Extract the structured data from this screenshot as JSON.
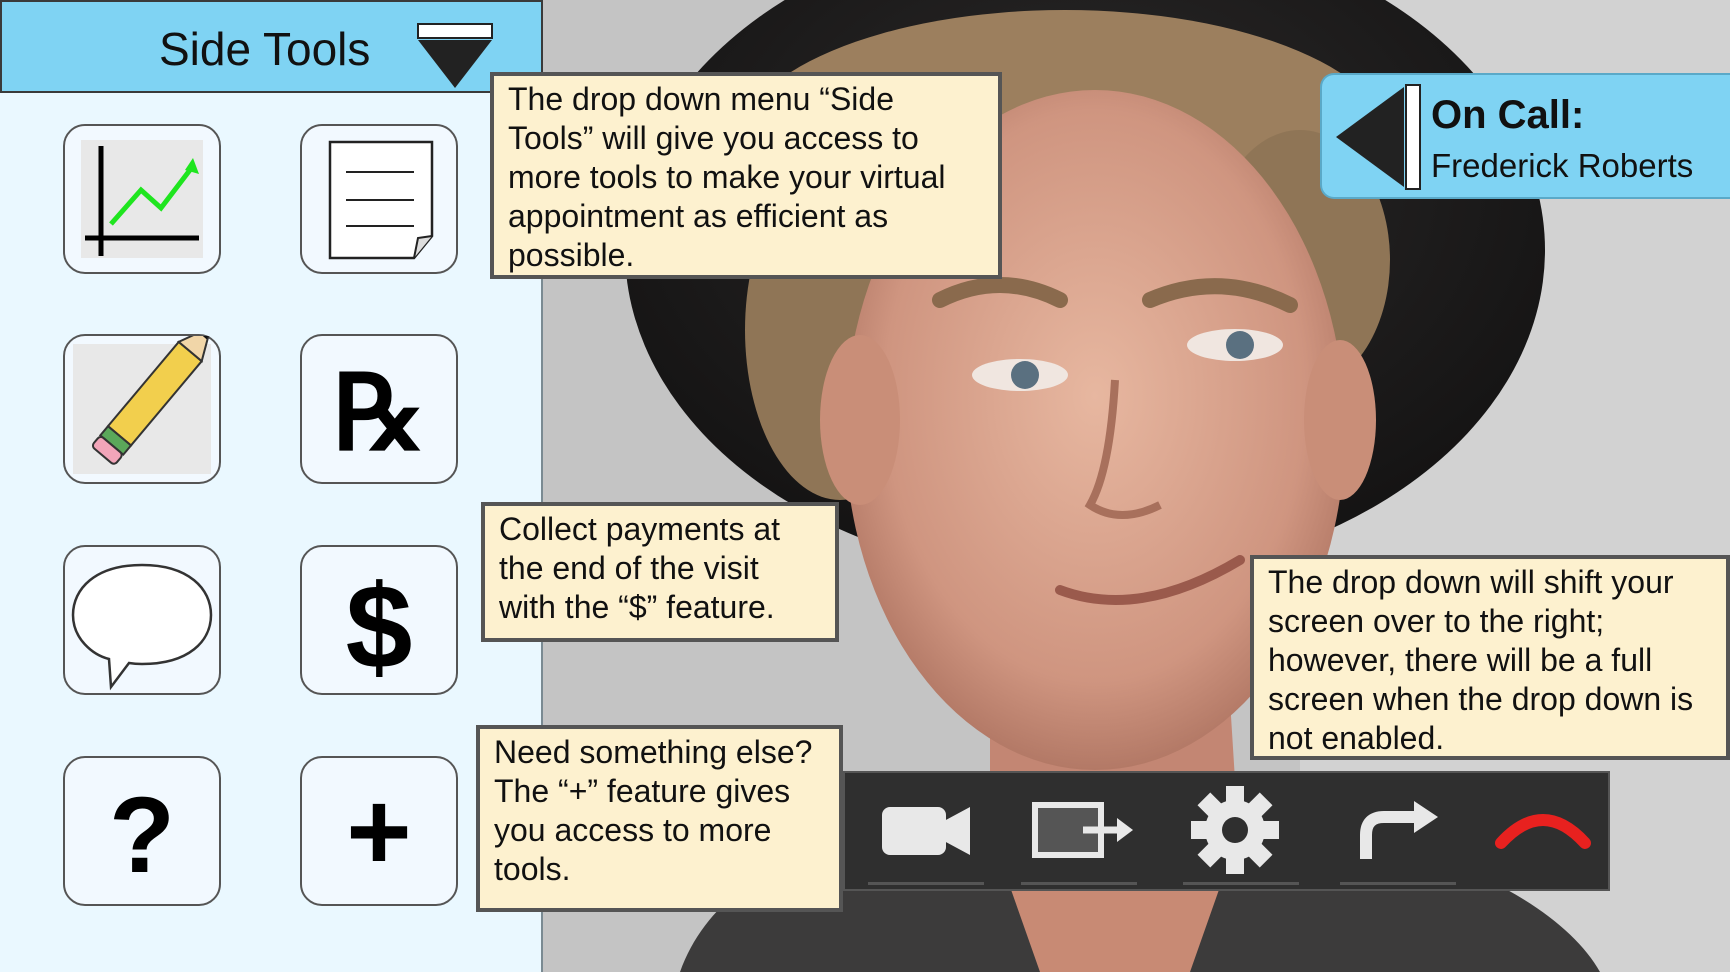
{
  "side_panel": {
    "title": "Side Tools",
    "tools": [
      {
        "icon": "chart-icon"
      },
      {
        "icon": "notes-document-icon"
      },
      {
        "icon": "pencil-icon"
      },
      {
        "icon": "prescription-rx-icon",
        "glyph": "℞"
      },
      {
        "icon": "chat-bubble-icon"
      },
      {
        "icon": "dollar-icon",
        "glyph": "$"
      },
      {
        "icon": "help-question-icon",
        "glyph": "?"
      },
      {
        "icon": "plus-icon",
        "glyph": "+"
      }
    ]
  },
  "callouts": {
    "side_tools": "The drop down menu “Side Tools”  will give you access to more tools to make your virtual appointment as efficient as possible.",
    "payments": "Collect payments at the end of the visit with the “$” feature.",
    "more_tools": "Need something else? The “+” feature gives you access to more tools.",
    "shift_screen": "The drop down will shift your screen over to the right; however, there will be a full screen when the drop down is not enabled."
  },
  "on_call": {
    "label": "On Call:",
    "name": "Frederick Roberts"
  },
  "controls": [
    {
      "icon": "video-camera-icon"
    },
    {
      "icon": "share-screen-icon"
    },
    {
      "icon": "settings-gear-icon"
    },
    {
      "icon": "forward-arrow-icon"
    },
    {
      "icon": "hang-up-icon"
    }
  ],
  "colors": {
    "panel_header": "#7fd3f3",
    "panel_bg": "#eaf8ff",
    "callout_bg": "#fdf1cf",
    "hang_up": "#e8211f",
    "control_icon": "#e8e8e8"
  }
}
